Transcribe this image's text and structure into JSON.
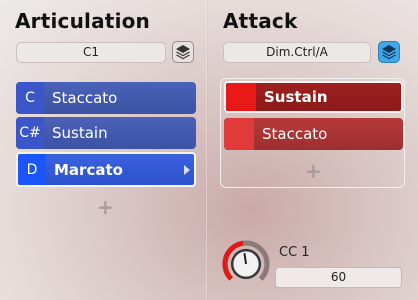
{
  "articulation": {
    "title": "Articulation",
    "key_field": "C1",
    "items": [
      {
        "note": "C",
        "label": "Staccato"
      },
      {
        "note": "C#",
        "label": "Sustain"
      },
      {
        "note": "D",
        "label": "Marcato"
      }
    ],
    "selected_index": 2,
    "add_symbol": "+"
  },
  "attack": {
    "title": "Attack",
    "mode_field": "Dim.Ctrl/A",
    "items": [
      {
        "label": "Sustain"
      },
      {
        "label": "Staccato"
      }
    ],
    "selected_index": 0,
    "add_symbol": "+",
    "cc_label": "CC 1",
    "cc_value": "60",
    "knob_level_fraction": 0.47
  },
  "colors": {
    "articulation_blue": "#3c52a3",
    "attack_red": "#9f2e2e",
    "layer_button_active": "#3fa7e6"
  },
  "icons": {
    "layer_button": "layers-icon",
    "arrow": "chevron-right-icon"
  }
}
